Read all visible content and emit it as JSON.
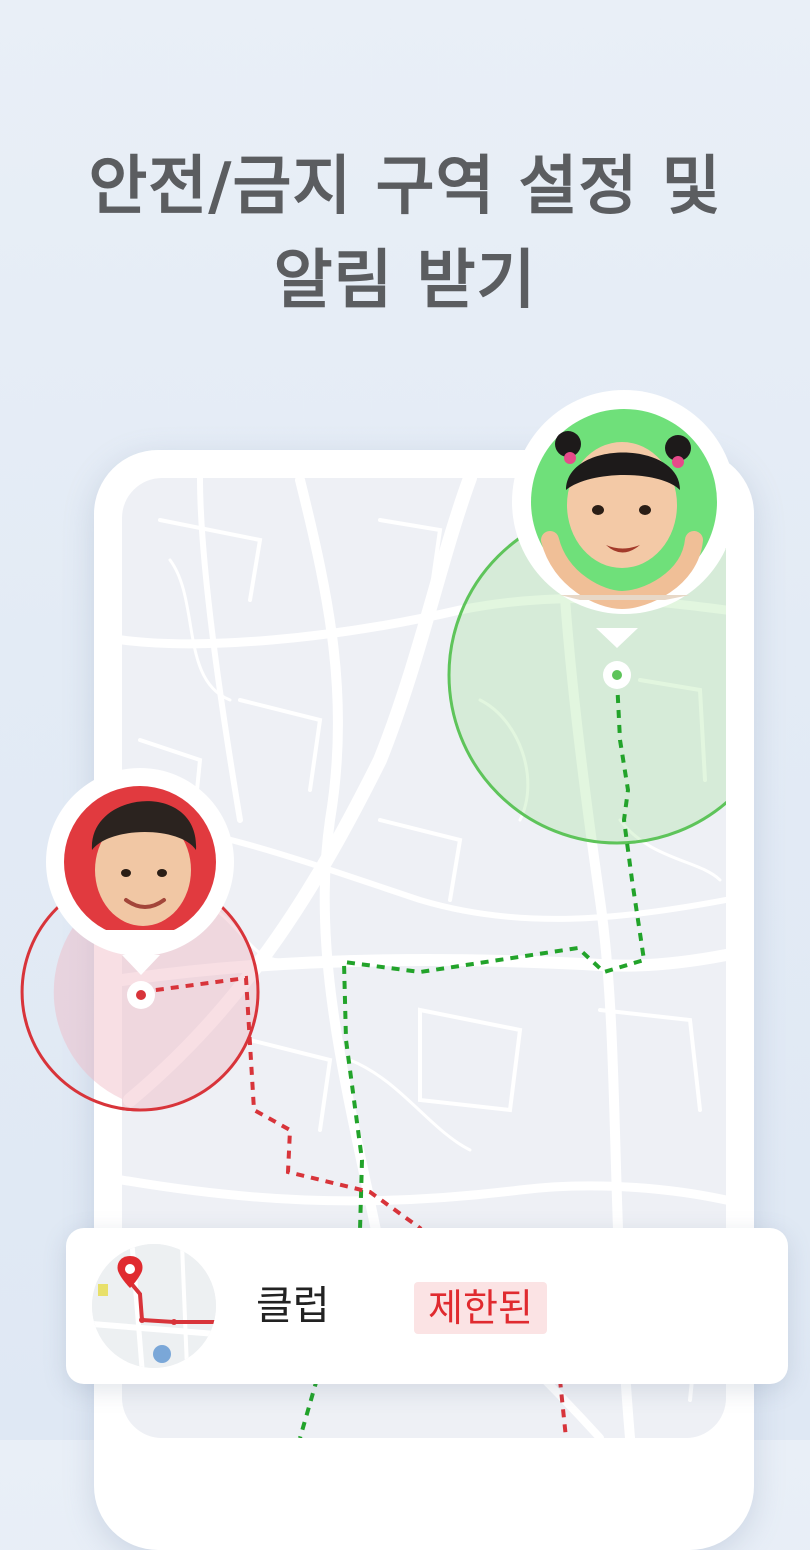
{
  "headline": {
    "line1": "안전/금지 구역 설정 및",
    "line2": "알림 받기"
  },
  "map": {
    "safe_zone_color": "#5ec45a",
    "restricted_zone_color": "#d8343a",
    "children": [
      {
        "name": "girl-avatar",
        "zone": "safe",
        "background": "#6fe07a"
      },
      {
        "name": "boy-avatar",
        "zone": "restricted",
        "background": "#e13a3f"
      }
    ]
  },
  "notification_card": {
    "label": "클럽",
    "status_badge": "제한된",
    "badge_color": "#e02a2f",
    "icon": "location-pin-icon"
  }
}
